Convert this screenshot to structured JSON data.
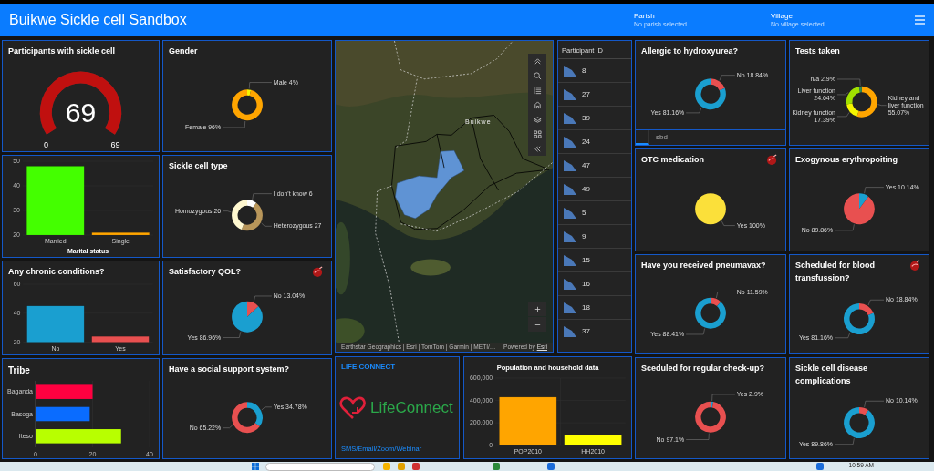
{
  "header": {
    "title": "Buikwe Sickle cell Sandbox",
    "filters": [
      {
        "label": "Parish",
        "value": "No parish selected"
      },
      {
        "label": "Village",
        "value": "No village selected"
      }
    ]
  },
  "columns": [
    {
      "kind": "stack",
      "panels": [
        {
          "kind": "gauge",
          "title": "Participants with sickle cell",
          "value": "69",
          "min_label": "0",
          "max_label": "69",
          "level": 1
        },
        {
          "kind": "bar",
          "chart_data": {
            "type": "bar",
            "xlabel": "Marital status",
            "categories": [
              "Married",
              "Single"
            ],
            "values": [
              48,
              21
            ],
            "colors": [
              "#44ff00",
              "#ffa500"
            ],
            "ylim": [
              20,
              50
            ],
            "yticks": [
              20,
              30,
              40,
              50
            ]
          }
        },
        {
          "kind": "bar",
          "title": "Any chronic conditions?",
          "chart_data": {
            "type": "bar",
            "categories": [
              "No",
              "Yes"
            ],
            "values": [
              45,
              24
            ],
            "colors": [
              "#1a9fd0",
              "#e85050"
            ],
            "ylim": [
              20,
              60
            ],
            "yticks": [
              20,
              40,
              60
            ]
          }
        },
        {
          "kind": "bar",
          "title": "Tribe",
          "chart_data": {
            "type": "bar",
            "orientation": "horizontal",
            "categories": [
              "Baganda",
              "Basoga",
              "Iteso"
            ],
            "values": [
              20,
              19,
              30
            ],
            "colors": [
              "#ff0040",
              "#0a6cff",
              "#b8ff00"
            ],
            "xlim": [
              0,
              40
            ],
            "xticks": [
              0,
              20,
              40
            ]
          }
        }
      ]
    },
    {
      "kind": "stack",
      "panels": [
        {
          "kind": "pie",
          "title": "Gender",
          "icon": false,
          "chart_data": {
            "type": "donut",
            "values": [
              4,
              96
            ],
            "colors": [
              "#f5f500",
              "#ffa500"
            ],
            "value_labels": [
              "Male 4%",
              "Female 96%"
            ]
          }
        },
        {
          "kind": "pie",
          "title": "Sickle cell type",
          "icon": false,
          "chart_data": {
            "type": "donut",
            "values": [
              6,
              27,
              26
            ],
            "colors": [
              "#ffffff",
              "#b8965a",
              "#fff8d0"
            ],
            "value_labels": [
              "I don't know 6",
              "Heterozygous 27",
              "Homozygous 26"
            ]
          }
        },
        {
          "kind": "pie",
          "title": "Satisfactory QOL?",
          "icon": true,
          "chart_data": {
            "type": "pie",
            "values": [
              13.04,
              86.96
            ],
            "colors": [
              "#e85050",
              "#1a9fd0"
            ],
            "value_labels": [
              "No 13.04%",
              "Yes 86.96%"
            ]
          }
        },
        {
          "kind": "pie",
          "title": "Have a social support system?",
          "icon": false,
          "chart_data": {
            "type": "donut",
            "values": [
              34.78,
              65.22
            ],
            "colors": [
              "#1a9fd0",
              "#e85050"
            ],
            "value_labels": [
              "Yes 34.78%",
              "No 65.22%"
            ]
          }
        }
      ]
    },
    {
      "kind": "center",
      "map": {
        "place_label": "Buikwe",
        "attribution": "Earthstar Geographics | Esri | TomTom | Garmin | METI/…",
        "powered_by": "Powered by",
        "powered_link": "Esri"
      },
      "participant_list": {
        "header": "Participant ID",
        "items": [
          "8",
          "27",
          "39",
          "24",
          "47",
          "49",
          "5",
          "9",
          "15",
          "16",
          "18",
          "37"
        ]
      },
      "life_connect": {
        "title": "LIFE CONNECT",
        "logo_text": "LifeConnect",
        "link": "SMS/Email/Zoom/Webinar"
      },
      "population": {
        "chart_data": {
          "type": "bar",
          "title": "Population and household data",
          "categories": [
            "POP2010",
            "HH2010"
          ],
          "values": [
            430000,
            90000
          ],
          "colors": [
            "#ffa500",
            "#ffff00"
          ],
          "ylim": [
            0,
            600000
          ],
          "yticks": [
            {
              "value": 0,
              "label": "0"
            },
            {
              "value": 200000,
              "label": "200,000"
            },
            {
              "value": 400000,
              "label": "400,000"
            },
            {
              "value": 600000,
              "label": "600,000"
            }
          ]
        }
      }
    },
    {
      "kind": "stack",
      "panels": [
        {
          "kind": "pie",
          "title": "Allergic to hydroxyurea?",
          "icon": false,
          "tabs": [
            {
              "label": "sbd",
              "selected": false
            }
          ],
          "chart_data": {
            "type": "donut",
            "values": [
              18.84,
              81.16
            ],
            "colors": [
              "#e85050",
              "#1a9fd0"
            ],
            "value_labels": [
              "No 18.84%",
              "Yes 81.16%"
            ]
          }
        },
        {
          "kind": "pie",
          "title": "OTC medication",
          "icon": true,
          "chart_data": {
            "type": "pie",
            "values": [
              100
            ],
            "colors": [
              "#fbe03a"
            ],
            "value_labels": [
              "Yes 100%"
            ]
          }
        },
        {
          "kind": "pie",
          "title": "Have you received pneumavax?",
          "icon": false,
          "chart_data": {
            "type": "donut",
            "values": [
              11.59,
              88.41
            ],
            "colors": [
              "#e85050",
              "#1a9fd0"
            ],
            "value_labels": [
              "No 11.59%",
              "Yes 88.41%"
            ]
          }
        },
        {
          "kind": "pie",
          "title": "Sceduled for regular check-up?",
          "icon": false,
          "chart_data": {
            "type": "donut",
            "values": [
              2.9,
              97.1
            ],
            "colors": [
              "#1a9fd0",
              "#e85050"
            ],
            "value_labels": [
              "Yes 2.9%",
              "No 97.1%"
            ]
          }
        }
      ]
    },
    {
      "kind": "stack",
      "panels": [
        {
          "kind": "pie",
          "title": "Tests taken",
          "icon": false,
          "chart_data": {
            "type": "donut",
            "values": [
              55.07,
              17.39,
              24.64,
              2.9
            ],
            "colors": [
              "#ffa500",
              "#f5f500",
              "#a0e000",
              "#2e8b57"
            ],
            "value_labels": [
              "Kidney and liver function 55.07%",
              "Kidney function 17.39%",
              "Liver function 24.64%",
              "n/a 2.9%"
            ]
          }
        },
        {
          "kind": "pie",
          "title": "Exogynous erythropoiting",
          "icon": false,
          "chart_data": {
            "type": "pie",
            "values": [
              10.14,
              89.86
            ],
            "colors": [
              "#1a9fd0",
              "#e85050"
            ],
            "value_labels": [
              "Yes 10.14%",
              "No 89.86%"
            ]
          }
        },
        {
          "kind": "pie",
          "title": "Scheduled for blood transfussion?",
          "icon": true,
          "chart_data": {
            "type": "donut",
            "values": [
              18.84,
              81.16
            ],
            "colors": [
              "#e85050",
              "#1a9fd0"
            ],
            "value_labels": [
              "No 18.84%",
              "Yes 81.16%"
            ]
          }
        },
        {
          "kind": "pie",
          "title": "Sickle cell disease complications",
          "icon": false,
          "chart_data": {
            "type": "donut",
            "values": [
              10.14,
              89.86
            ],
            "colors": [
              "#e85050",
              "#1a9fd0"
            ],
            "value_labels": [
              "No 10.14%",
              "Yes 89.86%"
            ]
          }
        }
      ]
    }
  ],
  "taskbar": {
    "clock": "10:59 AM"
  }
}
